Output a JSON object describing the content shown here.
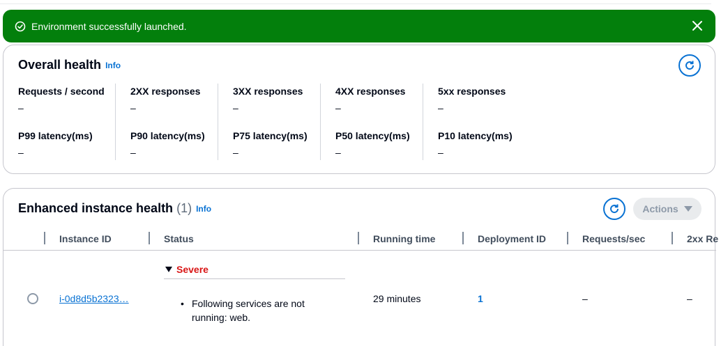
{
  "flash": {
    "message": "Environment successfully launched.",
    "icon": "check-circle-icon",
    "color": "#037f0c"
  },
  "overall_health": {
    "title": "Overall health",
    "info": "Info",
    "metrics_row1": [
      {
        "label": "Requests / second",
        "value": "–"
      },
      {
        "label": "2XX responses",
        "value": "–"
      },
      {
        "label": "3XX responses",
        "value": "–"
      },
      {
        "label": "4XX responses",
        "value": "–"
      },
      {
        "label": "5xx responses",
        "value": "–"
      }
    ],
    "metrics_row2": [
      {
        "label": "P99 latency(ms)",
        "value": "–"
      },
      {
        "label": "P90 latency(ms)",
        "value": "–"
      },
      {
        "label": "P75 latency(ms)",
        "value": "–"
      },
      {
        "label": "P50 latency(ms)",
        "value": "–"
      },
      {
        "label": "P10 latency(ms)",
        "value": "–"
      }
    ]
  },
  "instance_health": {
    "title": "Enhanced instance health",
    "count": "(1)",
    "info": "Info",
    "actions": "Actions",
    "columns": [
      "Instance ID",
      "Status",
      "Running time",
      "Deployment ID",
      "Requests/sec",
      "2xx Re"
    ],
    "rows": [
      {
        "instance_id": "i-0d8d5b2323…",
        "status": "Severe",
        "status_detail": "Following services are not running: web.",
        "running_time": "29 minutes",
        "deployment_id": "1",
        "requests_sec": "–",
        "responses_2xx": "–"
      }
    ]
  }
}
